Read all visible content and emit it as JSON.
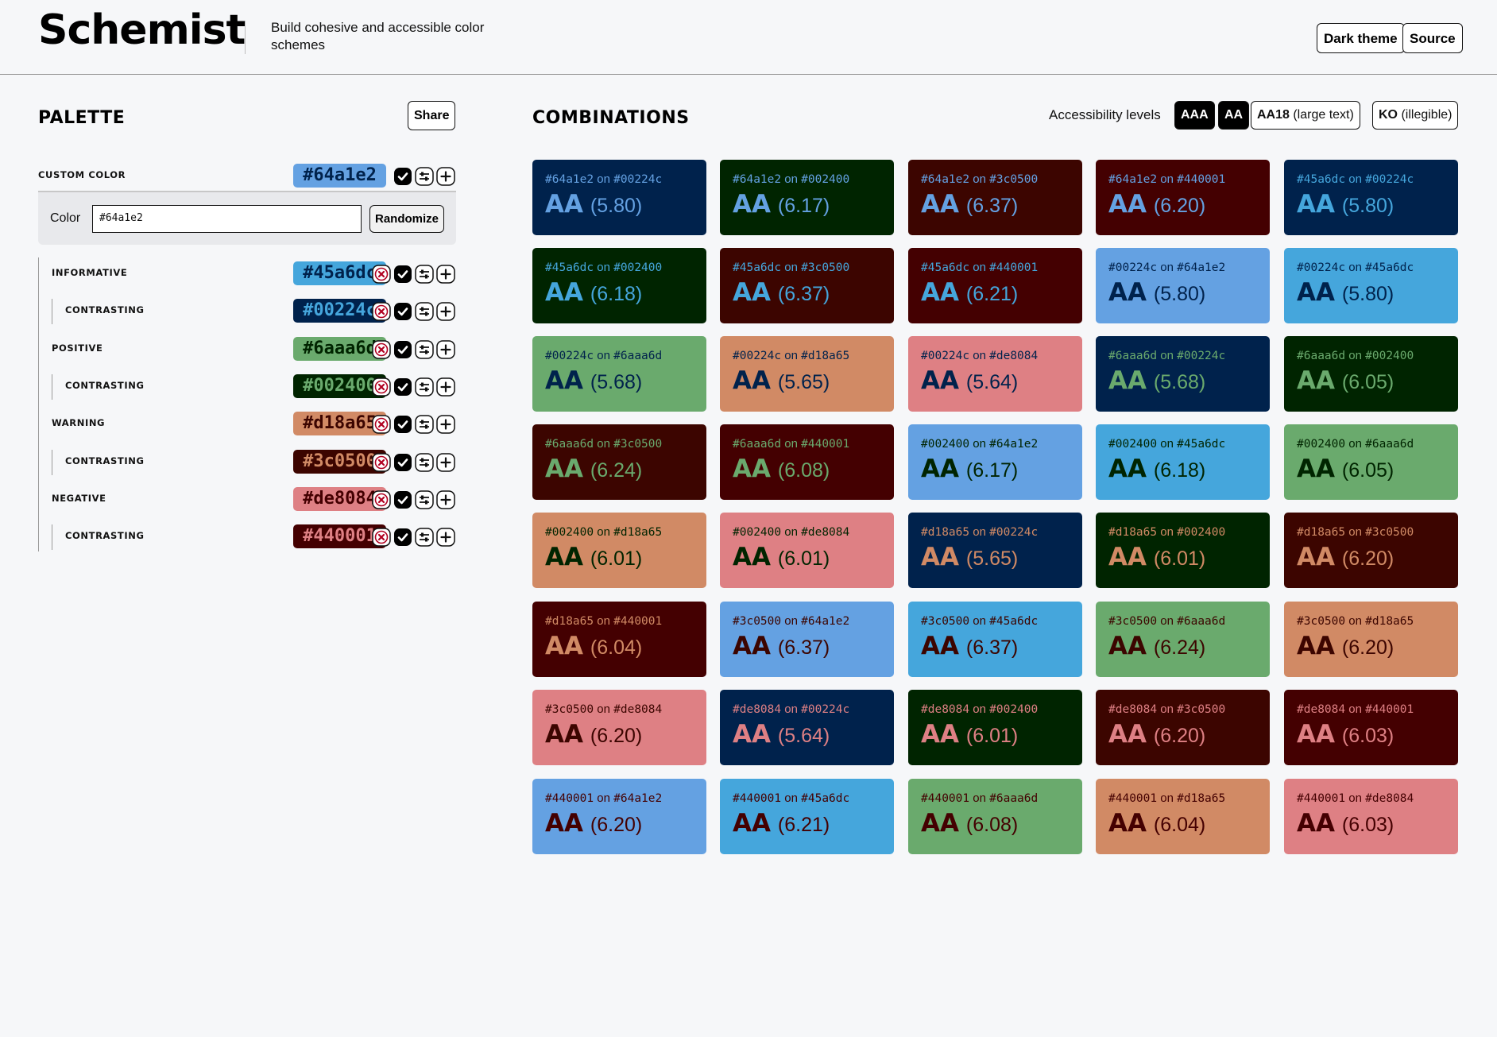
{
  "header": {
    "title": "Schemist",
    "tagline": "Build cohesive and accessible color schemes",
    "buttons": {
      "dark_theme": "Dark theme",
      "source": "Source"
    }
  },
  "palette": {
    "title": "PALETTE",
    "share_label": "Share",
    "custom": {
      "label": "CUSTOM COLOR",
      "hex": "#64a1e2",
      "fg": "#00224c"
    },
    "color_panel": {
      "label": "Color",
      "value": "#64a1e2",
      "randomize_label": "Randomize"
    },
    "rows": [
      {
        "label": "INFORMATIVE",
        "hex": "#45a6dc",
        "fg": "#00224c",
        "child": false
      },
      {
        "label": "CONTRASTING",
        "hex": "#00224c",
        "fg": "#45a6dc",
        "child": true
      },
      {
        "label": "POSITIVE",
        "hex": "#6aaa6d",
        "fg": "#002400",
        "child": false
      },
      {
        "label": "CONTRASTING",
        "hex": "#002400",
        "fg": "#6aaa6d",
        "child": true
      },
      {
        "label": "WARNING",
        "hex": "#d18a65",
        "fg": "#3c0500",
        "child": false
      },
      {
        "label": "CONTRASTING",
        "hex": "#3c0500",
        "fg": "#d18a65",
        "child": true
      },
      {
        "label": "NEGATIVE",
        "hex": "#de8084",
        "fg": "#440001",
        "child": false
      },
      {
        "label": "CONTRASTING",
        "hex": "#440001",
        "fg": "#de8084",
        "child": true
      }
    ],
    "icons": [
      "remove-icon",
      "check-icon",
      "adjust-icon",
      "add-icon"
    ]
  },
  "combinations": {
    "title": "COMBINATIONS",
    "levels_label": "Accessibility levels",
    "levels": [
      {
        "key": "AAA",
        "desc": "",
        "active": true
      },
      {
        "key": "AA",
        "desc": "",
        "active": true
      },
      {
        "key": "AA18",
        "desc": "(large text)",
        "active": false
      },
      {
        "key": "KO",
        "desc": "(illegible)",
        "active": false
      }
    ],
    "on_word": "on",
    "cards": [
      {
        "fg": "#64a1e2",
        "bg": "#00224c",
        "level": "AA",
        "ratio": "(5.80)"
      },
      {
        "fg": "#64a1e2",
        "bg": "#002400",
        "level": "AA",
        "ratio": "(6.17)"
      },
      {
        "fg": "#64a1e2",
        "bg": "#3c0500",
        "level": "AA",
        "ratio": "(6.37)"
      },
      {
        "fg": "#64a1e2",
        "bg": "#440001",
        "level": "AA",
        "ratio": "(6.20)"
      },
      {
        "fg": "#45a6dc",
        "bg": "#00224c",
        "level": "AA",
        "ratio": "(5.80)"
      },
      {
        "fg": "#45a6dc",
        "bg": "#002400",
        "level": "AA",
        "ratio": "(6.18)"
      },
      {
        "fg": "#45a6dc",
        "bg": "#3c0500",
        "level": "AA",
        "ratio": "(6.37)"
      },
      {
        "fg": "#45a6dc",
        "bg": "#440001",
        "level": "AA",
        "ratio": "(6.21)"
      },
      {
        "fg": "#00224c",
        "bg": "#64a1e2",
        "level": "AA",
        "ratio": "(5.80)"
      },
      {
        "fg": "#00224c",
        "bg": "#45a6dc",
        "level": "AA",
        "ratio": "(5.80)"
      },
      {
        "fg": "#00224c",
        "bg": "#6aaa6d",
        "level": "AA",
        "ratio": "(5.68)"
      },
      {
        "fg": "#00224c",
        "bg": "#d18a65",
        "level": "AA",
        "ratio": "(5.65)"
      },
      {
        "fg": "#00224c",
        "bg": "#de8084",
        "level": "AA",
        "ratio": "(5.64)"
      },
      {
        "fg": "#6aaa6d",
        "bg": "#00224c",
        "level": "AA",
        "ratio": "(5.68)"
      },
      {
        "fg": "#6aaa6d",
        "bg": "#002400",
        "level": "AA",
        "ratio": "(6.05)"
      },
      {
        "fg": "#6aaa6d",
        "bg": "#3c0500",
        "level": "AA",
        "ratio": "(6.24)"
      },
      {
        "fg": "#6aaa6d",
        "bg": "#440001",
        "level": "AA",
        "ratio": "(6.08)"
      },
      {
        "fg": "#002400",
        "bg": "#64a1e2",
        "level": "AA",
        "ratio": "(6.17)"
      },
      {
        "fg": "#002400",
        "bg": "#45a6dc",
        "level": "AA",
        "ratio": "(6.18)"
      },
      {
        "fg": "#002400",
        "bg": "#6aaa6d",
        "level": "AA",
        "ratio": "(6.05)"
      },
      {
        "fg": "#002400",
        "bg": "#d18a65",
        "level": "AA",
        "ratio": "(6.01)"
      },
      {
        "fg": "#002400",
        "bg": "#de8084",
        "level": "AA",
        "ratio": "(6.01)"
      },
      {
        "fg": "#d18a65",
        "bg": "#00224c",
        "level": "AA",
        "ratio": "(5.65)"
      },
      {
        "fg": "#d18a65",
        "bg": "#002400",
        "level": "AA",
        "ratio": "(6.01)"
      },
      {
        "fg": "#d18a65",
        "bg": "#3c0500",
        "level": "AA",
        "ratio": "(6.20)"
      },
      {
        "fg": "#d18a65",
        "bg": "#440001",
        "level": "AA",
        "ratio": "(6.04)"
      },
      {
        "fg": "#3c0500",
        "bg": "#64a1e2",
        "level": "AA",
        "ratio": "(6.37)"
      },
      {
        "fg": "#3c0500",
        "bg": "#45a6dc",
        "level": "AA",
        "ratio": "(6.37)"
      },
      {
        "fg": "#3c0500",
        "bg": "#6aaa6d",
        "level": "AA",
        "ratio": "(6.24)"
      },
      {
        "fg": "#3c0500",
        "bg": "#d18a65",
        "level": "AA",
        "ratio": "(6.20)"
      },
      {
        "fg": "#3c0500",
        "bg": "#de8084",
        "level": "AA",
        "ratio": "(6.20)"
      },
      {
        "fg": "#de8084",
        "bg": "#00224c",
        "level": "AA",
        "ratio": "(5.64)"
      },
      {
        "fg": "#de8084",
        "bg": "#002400",
        "level": "AA",
        "ratio": "(6.01)"
      },
      {
        "fg": "#de8084",
        "bg": "#3c0500",
        "level": "AA",
        "ratio": "(6.20)"
      },
      {
        "fg": "#de8084",
        "bg": "#440001",
        "level": "AA",
        "ratio": "(6.03)"
      },
      {
        "fg": "#440001",
        "bg": "#64a1e2",
        "level": "AA",
        "ratio": "(6.20)"
      },
      {
        "fg": "#440001",
        "bg": "#45a6dc",
        "level": "AA",
        "ratio": "(6.21)"
      },
      {
        "fg": "#440001",
        "bg": "#6aaa6d",
        "level": "AA",
        "ratio": "(6.08)"
      },
      {
        "fg": "#440001",
        "bg": "#d18a65",
        "level": "AA",
        "ratio": "(6.04)"
      },
      {
        "fg": "#440001",
        "bg": "#de8084",
        "level": "AA",
        "ratio": "(6.03)"
      }
    ]
  },
  "colors": {
    "page_bg": "#f6f7f9",
    "ink": "#000000",
    "remove_red": "#b00020"
  }
}
